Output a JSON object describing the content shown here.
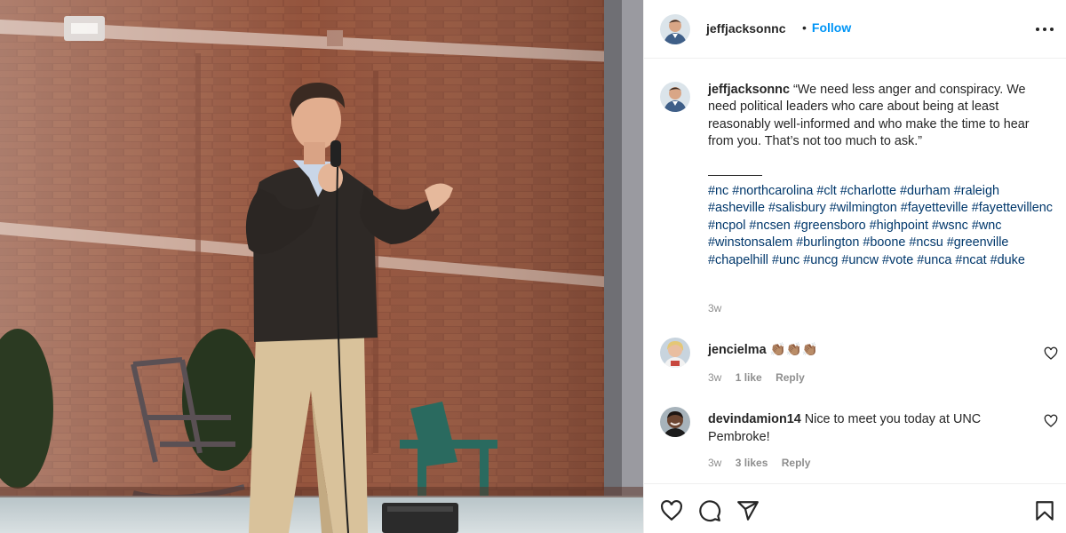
{
  "post": {
    "username": "jeffjacksonnc",
    "separator": "•",
    "follow_label": "Follow",
    "more_icon": "more-horizontal-icon"
  },
  "caption": {
    "username": "jeffjacksonnc",
    "text": "“We need less anger and conspiracy. We need political leaders who care about being at least reasonably well-informed and who make the time to hear from you. That’s not too much to ask.”",
    "hashtags": "#nc #northcarolina #clt #charlotte #durham #raleigh #asheville #salisbury #wilmington #fayetteville #fayettevillenc #ncpol #ncsen #greensboro #highpoint #wsnc #wnc #winstonsalem #burlington #boone #ncsu #greenville #chapelhill #unc #uncg #uncw #vote #unca #ncat #duke",
    "time": "3w"
  },
  "comments": [
    {
      "username": "jencielma",
      "text": "👏🏽👏🏽👏🏽",
      "time": "3w",
      "likes": "1 like",
      "reply": "Reply"
    },
    {
      "username": "devindamion14",
      "text": "Nice to meet you today at UNC Pembroke!",
      "time": "3w",
      "likes": "3 likes",
      "reply": "Reply"
    }
  ],
  "actions": [
    "heart-icon",
    "comment-icon",
    "share-icon",
    "save-icon"
  ],
  "colors": {
    "link": "#0095f6",
    "hashtag": "#00376b",
    "muted": "#8e8e8e",
    "text": "#262626"
  }
}
